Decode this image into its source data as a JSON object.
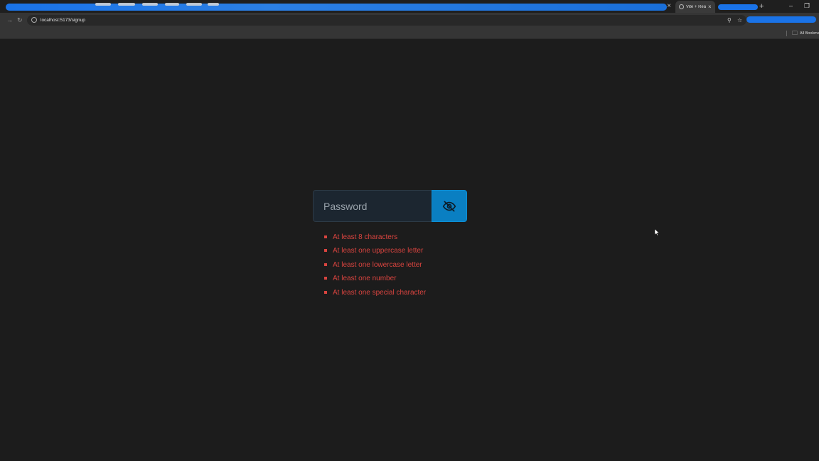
{
  "browser": {
    "active_tab_title": "Vite + React",
    "url": "localhost:5173/signup",
    "bookmarks_label": "All Bookmarks",
    "accent_color": "#1a73e8"
  },
  "form": {
    "password_placeholder": "Password",
    "toggle_icon": "eye-slash-icon",
    "toggle_color": "#0a7fc2"
  },
  "requirements": {
    "color": "#d9443f",
    "items": [
      "At least 8 characters",
      "At least one uppercase letter",
      "At least one lowercase letter",
      "At least one number",
      "At least one special character"
    ]
  }
}
